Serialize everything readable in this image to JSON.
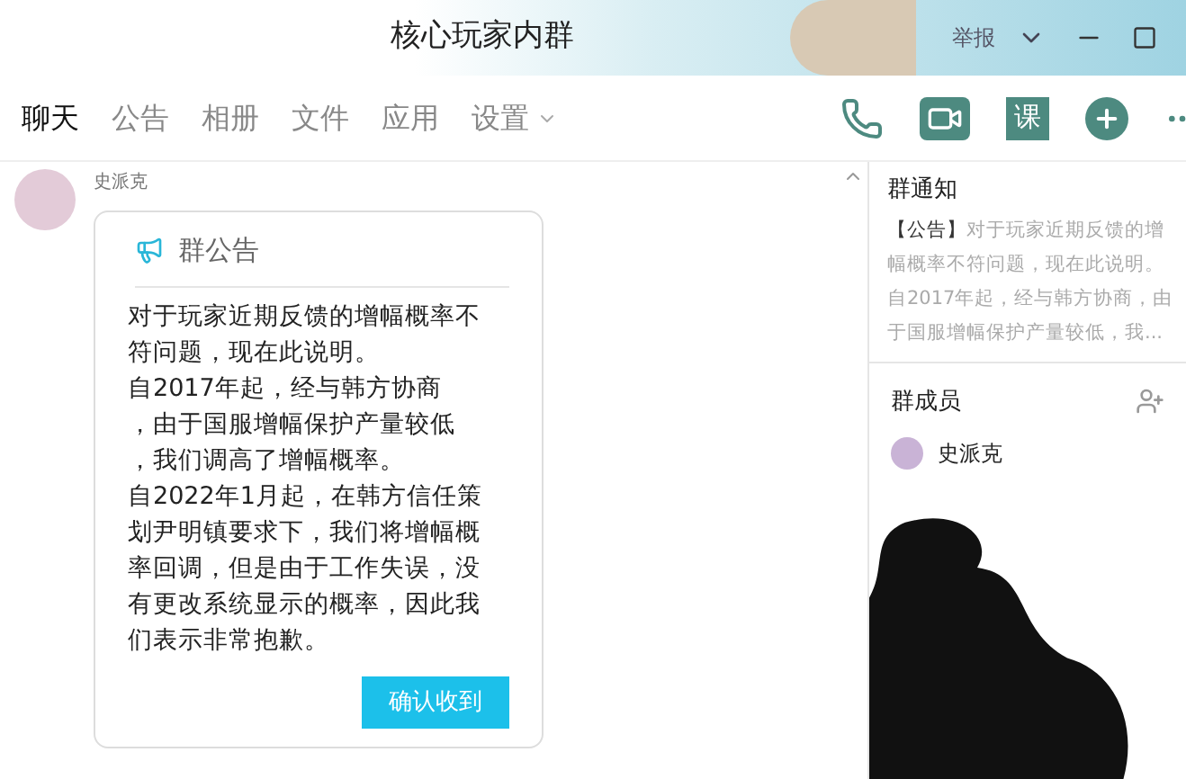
{
  "window": {
    "title": "核心玩家内群",
    "report": "举报"
  },
  "tabs": [
    {
      "label": "聊天",
      "selected": true,
      "dropdown": false
    },
    {
      "label": "公告",
      "selected": false,
      "dropdown": false
    },
    {
      "label": "相册",
      "selected": false,
      "dropdown": false
    },
    {
      "label": "文件",
      "selected": false,
      "dropdown": false
    },
    {
      "label": "应用",
      "selected": false,
      "dropdown": false
    },
    {
      "label": "设置",
      "selected": false,
      "dropdown": true
    }
  ],
  "toolbar": [
    {
      "kind": "phone"
    },
    {
      "kind": "video"
    },
    {
      "kind": "class",
      "label": "课"
    },
    {
      "kind": "plus"
    },
    {
      "kind": "more"
    }
  ],
  "message": {
    "sender": "史派克",
    "card": {
      "title": "群公告",
      "lines": [
        "对于玩家近期反馈的增幅概率不",
        "符问题，现在此说明。",
        "自2017年起，经与韩方协商",
        "，由于国服增幅保护产量较低",
        "，我们调高了增幅概率。",
        "自2022年1月起，在韩方信任策",
        "划尹明镇要求下，我们将增幅概",
        "率回调，但是由于工作失误，没",
        "有更改系统显示的概率，因此我",
        "们表示非常抱歉。"
      ],
      "button": "确认收到"
    }
  },
  "notice": {
    "title": "群通知",
    "tag": "【公告】",
    "lines": [
      "对于玩家近期反馈的增",
      "幅概率不符问题，现在此说明。",
      "自2017年起，经与韩方协商，由",
      "于国服增幅保护产量较低，我..."
    ]
  },
  "members": {
    "title": "群成员",
    "items": [
      {
        "name": "史派克"
      }
    ]
  }
}
